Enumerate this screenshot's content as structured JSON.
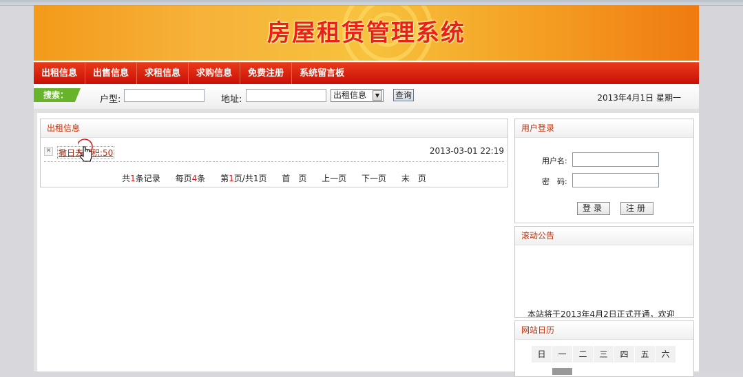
{
  "site": {
    "title": "房屋租赁管理系统"
  },
  "nav": {
    "items": [
      "出租信息",
      "出售信息",
      "求租信息",
      "求购信息",
      "免费注册",
      "系统留言板"
    ]
  },
  "search": {
    "tag": "搜索：",
    "type_label": "户型:",
    "type_value": "",
    "address_label": "地址:",
    "address_value": "",
    "category_selected": "出租信息",
    "submit_label": "查询",
    "date_text": "2013年4月1日 星期一"
  },
  "rental": {
    "header": "出租信息",
    "items": [
      {
        "title": "撒日去面积:50",
        "time": "2013-03-01 22:19"
      }
    ],
    "pager": {
      "total_prefix": "共",
      "total": "1",
      "total_suffix": "条记录",
      "per_prefix": "每页",
      "per": "4",
      "per_suffix": "条",
      "page_prefix": "第",
      "page": "1",
      "page_suffix": "页/共1页",
      "first": "首　页",
      "prev": "上一页",
      "next": "下一页",
      "last": "末　页"
    }
  },
  "login": {
    "header": "用户登录",
    "username_label": "用户名:",
    "password_label": "密　码:",
    "login_button": "登录",
    "register_button": "注册"
  },
  "notice": {
    "header": "滚动公告",
    "scroll_text": "本站将于2013年4月2日正式开通，欢迎"
  },
  "calendar": {
    "header": "网站日历",
    "weekdays": [
      "日",
      "一",
      "二",
      "三",
      "四",
      "五",
      "六"
    ]
  },
  "colors": {
    "accent_red": "#d41a0c",
    "header_text": "#c8320a",
    "search_tag_green": "#67b42a"
  }
}
